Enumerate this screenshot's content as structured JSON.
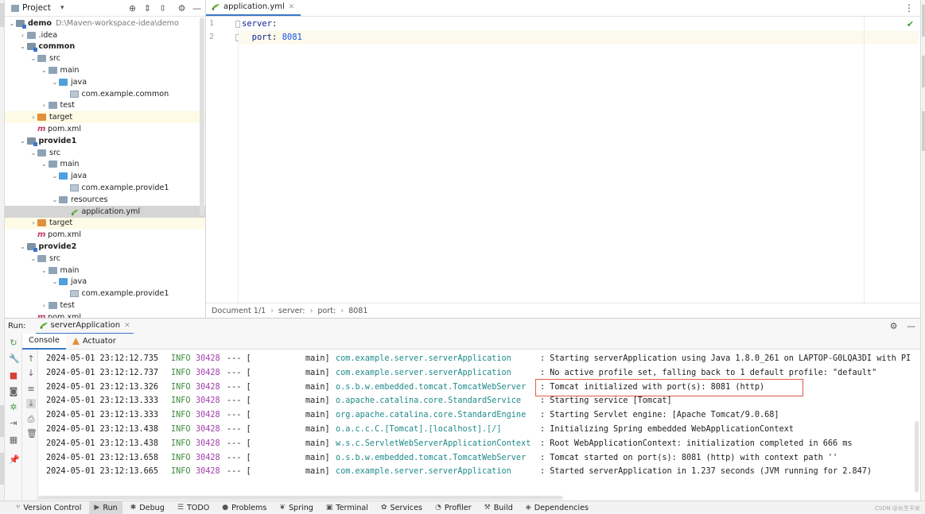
{
  "project": {
    "title": "Project",
    "tree": [
      {
        "arrow": "⌄",
        "icon": "module",
        "label": "demo",
        "bold": true,
        "path": "D:\\Maven-workspace-idea\\demo",
        "indent": 0,
        "hl": ""
      },
      {
        "arrow": "›",
        "icon": "folder",
        "label": ".idea",
        "bold": false,
        "path": "",
        "indent": 1,
        "hl": ""
      },
      {
        "arrow": "⌄",
        "icon": "module",
        "label": "common",
        "bold": true,
        "path": "",
        "indent": 1,
        "hl": ""
      },
      {
        "arrow": "⌄",
        "icon": "folder",
        "label": "src",
        "bold": false,
        "path": "",
        "indent": 2,
        "hl": ""
      },
      {
        "arrow": "⌄",
        "icon": "folder",
        "label": "main",
        "bold": false,
        "path": "",
        "indent": 3,
        "hl": ""
      },
      {
        "arrow": "⌄",
        "icon": "folder-blue",
        "label": "java",
        "bold": false,
        "path": "",
        "indent": 4,
        "hl": ""
      },
      {
        "arrow": "",
        "icon": "pkg",
        "label": "com.example.common",
        "bold": false,
        "path": "",
        "indent": 5,
        "hl": ""
      },
      {
        "arrow": "›",
        "icon": "folder",
        "label": "test",
        "bold": false,
        "path": "",
        "indent": 3,
        "hl": ""
      },
      {
        "arrow": "›",
        "icon": "folder-orange",
        "label": "target",
        "bold": false,
        "path": "",
        "indent": 2,
        "hl": "yellow"
      },
      {
        "arrow": "",
        "icon": "maven",
        "label": "pom.xml",
        "bold": false,
        "path": "",
        "indent": 2,
        "hl": ""
      },
      {
        "arrow": "⌄",
        "icon": "module",
        "label": "provide1",
        "bold": true,
        "path": "",
        "indent": 1,
        "hl": ""
      },
      {
        "arrow": "⌄",
        "icon": "folder",
        "label": "src",
        "bold": false,
        "path": "",
        "indent": 2,
        "hl": ""
      },
      {
        "arrow": "⌄",
        "icon": "folder",
        "label": "main",
        "bold": false,
        "path": "",
        "indent": 3,
        "hl": ""
      },
      {
        "arrow": "⌄",
        "icon": "folder-blue",
        "label": "java",
        "bold": false,
        "path": "",
        "indent": 4,
        "hl": ""
      },
      {
        "arrow": "",
        "icon": "pkg",
        "label": "com.example.provide1",
        "bold": false,
        "path": "",
        "indent": 5,
        "hl": ""
      },
      {
        "arrow": "⌄",
        "icon": "folder",
        "label": "resources",
        "bold": false,
        "path": "",
        "indent": 4,
        "hl": ""
      },
      {
        "arrow": "",
        "icon": "yml",
        "label": "application.yml",
        "bold": false,
        "path": "",
        "indent": 5,
        "hl": "selected"
      },
      {
        "arrow": "›",
        "icon": "folder-orange",
        "label": "target",
        "bold": false,
        "path": "",
        "indent": 2,
        "hl": "yellow"
      },
      {
        "arrow": "",
        "icon": "maven",
        "label": "pom.xml",
        "bold": false,
        "path": "",
        "indent": 2,
        "hl": ""
      },
      {
        "arrow": "⌄",
        "icon": "module",
        "label": "provide2",
        "bold": true,
        "path": "",
        "indent": 1,
        "hl": ""
      },
      {
        "arrow": "⌄",
        "icon": "folder",
        "label": "src",
        "bold": false,
        "path": "",
        "indent": 2,
        "hl": ""
      },
      {
        "arrow": "⌄",
        "icon": "folder",
        "label": "main",
        "bold": false,
        "path": "",
        "indent": 3,
        "hl": ""
      },
      {
        "arrow": "⌄",
        "icon": "folder-blue",
        "label": "java",
        "bold": false,
        "path": "",
        "indent": 4,
        "hl": ""
      },
      {
        "arrow": "",
        "icon": "pkg",
        "label": "com.example.provide1",
        "bold": false,
        "path": "",
        "indent": 5,
        "hl": ""
      },
      {
        "arrow": "›",
        "icon": "folder",
        "label": "test",
        "bold": false,
        "path": "",
        "indent": 3,
        "hl": ""
      },
      {
        "arrow": "",
        "icon": "maven",
        "label": "pom.xml",
        "bold": false,
        "path": "",
        "indent": 2,
        "hl": ""
      }
    ]
  },
  "editor": {
    "tab_label": "application.yml",
    "lines": [
      {
        "no": "1",
        "key": "server",
        "sep": ":",
        "value": ""
      },
      {
        "no": "2",
        "key": "  port",
        "sep": ": ",
        "value": "8081"
      }
    ],
    "breadcrumb": [
      "Document 1/1",
      "server:",
      "port:",
      "8081"
    ]
  },
  "run": {
    "label": "Run:",
    "config": "serverApplication",
    "tabs": [
      "Console",
      "Actuator"
    ],
    "log": [
      {
        "ts": "2024-05-01 23:12:12.735",
        "level": "INFO",
        "pid": "30428",
        "sep": "--- [",
        "thread": "main]",
        "logger": "com.example.server.serverApplication",
        "msg": ": Starting serverApplication using Java 1.8.0_261 on LAPTOP-G0LQA3DI with PI"
      },
      {
        "ts": "2024-05-01 23:12:12.737",
        "level": "INFO",
        "pid": "30428",
        "sep": "--- [",
        "thread": "main]",
        "logger": "com.example.server.serverApplication",
        "msg": ": No active profile set, falling back to 1 default profile: \"default\""
      },
      {
        "ts": "2024-05-01 23:12:13.326",
        "level": "INFO",
        "pid": "30428",
        "sep": "--- [",
        "thread": "main]",
        "logger": "o.s.b.w.embedded.tomcat.TomcatWebServer",
        "msg": ": Tomcat initialized with port(s): 8081 (http)"
      },
      {
        "ts": "2024-05-01 23:12:13.333",
        "level": "INFO",
        "pid": "30428",
        "sep": "--- [",
        "thread": "main]",
        "logger": "o.apache.catalina.core.StandardService",
        "msg": ": Starting service [Tomcat]"
      },
      {
        "ts": "2024-05-01 23:12:13.333",
        "level": "INFO",
        "pid": "30428",
        "sep": "--- [",
        "thread": "main]",
        "logger": "org.apache.catalina.core.StandardEngine",
        "msg": ": Starting Servlet engine: [Apache Tomcat/9.0.68]"
      },
      {
        "ts": "2024-05-01 23:12:13.438",
        "level": "INFO",
        "pid": "30428",
        "sep": "--- [",
        "thread": "main]",
        "logger": "o.a.c.c.C.[Tomcat].[localhost].[/]",
        "msg": ": Initializing Spring embedded WebApplicationContext"
      },
      {
        "ts": "2024-05-01 23:12:13.438",
        "level": "INFO",
        "pid": "30428",
        "sep": "--- [",
        "thread": "main]",
        "logger": "w.s.c.ServletWebServerApplicationContext",
        "msg": ": Root WebApplicationContext: initialization completed in 666 ms"
      },
      {
        "ts": "2024-05-01 23:12:13.658",
        "level": "INFO",
        "pid": "30428",
        "sep": "--- [",
        "thread": "main]",
        "logger": "o.s.b.w.embedded.tomcat.TomcatWebServer",
        "msg": ": Tomcat started on port(s): 8081 (http) with context path ''"
      },
      {
        "ts": "2024-05-01 23:12:13.665",
        "level": "INFO",
        "pid": "30428",
        "sep": "--- [",
        "thread": "main]",
        "logger": "com.example.server.serverApplication",
        "msg": ": Started serverApplication in 1.237 seconds (JVM running for 2.847)"
      }
    ]
  },
  "bottom_bar": [
    {
      "icon": "⑂",
      "label": "Version Control",
      "active": false
    },
    {
      "icon": "▶",
      "label": "Run",
      "active": true
    },
    {
      "icon": "✱",
      "label": "Debug",
      "active": false
    },
    {
      "icon": "☰",
      "label": "TODO",
      "active": false
    },
    {
      "icon": "●",
      "label": "Problems",
      "active": false
    },
    {
      "icon": "❦",
      "label": "Spring",
      "active": false
    },
    {
      "icon": "▣",
      "label": "Terminal",
      "active": false
    },
    {
      "icon": "✿",
      "label": "Services",
      "active": false
    },
    {
      "icon": "◔",
      "label": "Profiler",
      "active": false
    },
    {
      "icon": "⚒",
      "label": "Build",
      "active": false
    },
    {
      "icon": "◈",
      "label": "Dependencies",
      "active": false
    }
  ],
  "watermark": "CSDN @长生平安",
  "colors": {
    "accent": "#3a77c8",
    "highlight_box": "#e05a4a",
    "info": "#3c8a3c",
    "pid": "#a03faa",
    "logger": "#1f8a8a"
  }
}
